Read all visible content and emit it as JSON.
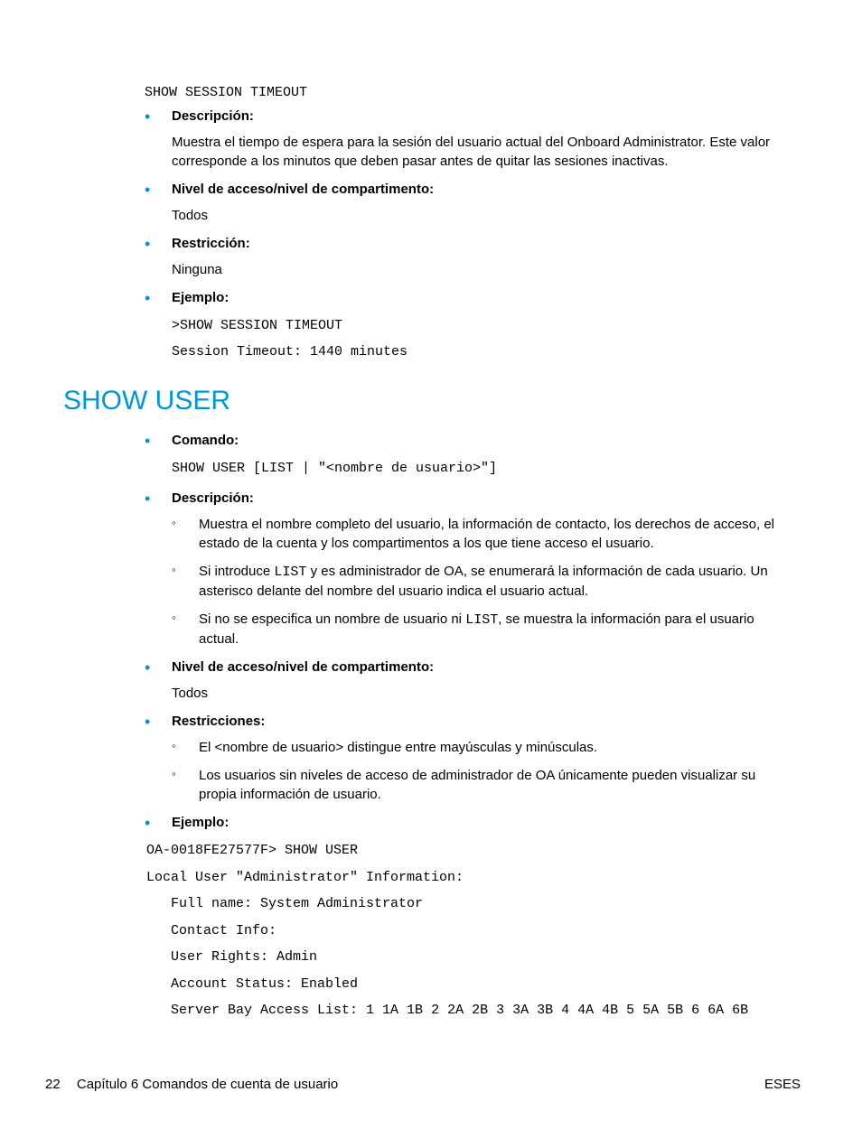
{
  "section1": {
    "command_code": "SHOW SESSION TIMEOUT",
    "description_label": "Descripción:",
    "description_text": "Muestra el tiempo de espera para la sesión del usuario actual del Onboard Administrator. Este valor corresponde a los minutos que deben pasar antes de quitar las sesiones inactivas.",
    "access_label": "Nivel de acceso/nivel de compartimento:",
    "access_text": "Todos",
    "restriction_label": "Restricción:",
    "restriction_text": "Ninguna",
    "example_label": "Ejemplo:",
    "example_code_1": ">SHOW SESSION TIMEOUT",
    "example_code_2": "Session Timeout: 1440 minutes"
  },
  "heading": "SHOW USER",
  "section2": {
    "command_label": "Comando:",
    "command_code": "SHOW USER [LIST | \"<nombre de usuario>\"]",
    "description_label": "Descripción:",
    "desc_sub_1": "Muestra el nombre completo del usuario, la información de contacto, los derechos de acceso, el estado de la cuenta y los compartimentos a los que tiene acceso el usuario.",
    "desc_sub_2_pre": "Si introduce ",
    "desc_sub_2_code": "LIST",
    "desc_sub_2_post": " y es administrador de OA, se enumerará la información de cada usuario. Un asterisco delante del nombre del usuario indica el usuario actual.",
    "desc_sub_3_pre": "Si no se especifica un nombre de usuario ni ",
    "desc_sub_3_code": "LIST",
    "desc_sub_3_post": ", se muestra la información para el usuario actual.",
    "access_label": "Nivel de acceso/nivel de compartimento:",
    "access_text": "Todos",
    "restrictions_label": "Restricciones:",
    "rest_sub_1": "El <nombre de usuario> distingue entre mayúsculas y minúsculas.",
    "rest_sub_2": "Los usuarios sin niveles de acceso de administrador de OA únicamente pueden visualizar su propia información de usuario.",
    "example_label": "Ejemplo:",
    "ex_line_1": "OA-0018FE27577F> SHOW USER",
    "ex_line_2": "Local User \"Administrator\" Information:",
    "ex_line_3": "   Full name: System Administrator",
    "ex_line_4": "   Contact Info:",
    "ex_line_5": "   User Rights: Admin",
    "ex_line_6": "   Account Status: Enabled",
    "ex_line_7": "   Server Bay Access List: 1 1A 1B 2 2A 2B 3 3A 3B 4 4A 4B 5 5A 5B 6 6A 6B"
  },
  "footer": {
    "page_number": "22",
    "chapter": "Capítulo 6   Comandos de cuenta de usuario",
    "right": "ESES"
  }
}
